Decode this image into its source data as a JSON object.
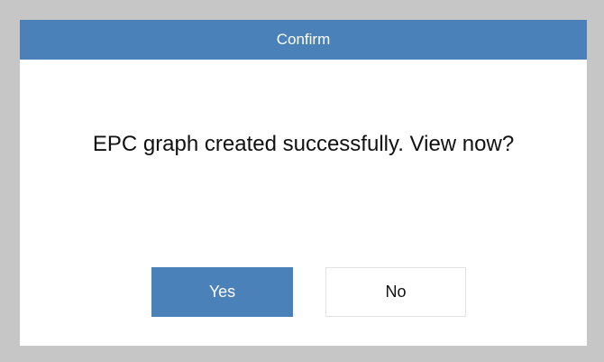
{
  "dialog": {
    "title": "Confirm",
    "message": "EPC graph created successfully. View now?",
    "buttons": {
      "yes_label": "Yes",
      "no_label": "No"
    }
  },
  "colors": {
    "accent": "#4b81b9",
    "backdrop": "#c6c6c6",
    "dialog_background": "#ffffff"
  }
}
